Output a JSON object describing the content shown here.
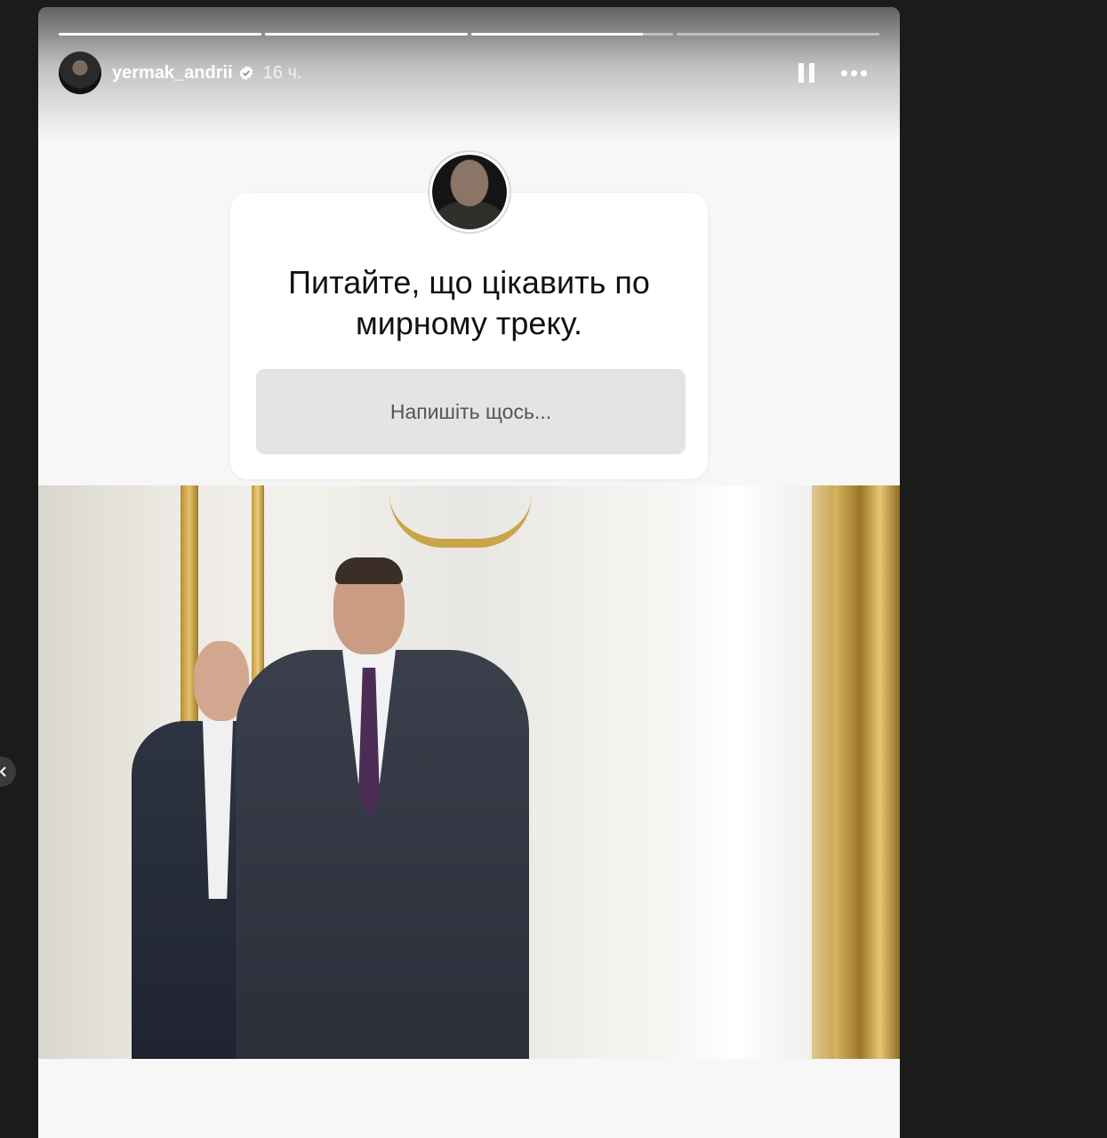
{
  "story": {
    "username": "yermak_andrii",
    "time_ago": "16 ч.",
    "progress": [
      1.0,
      1.0,
      0.85,
      0.0
    ]
  },
  "question_sticker": {
    "question": "Питайте, що цікавить по мирному треку.",
    "placeholder": "Напишіть щось..."
  },
  "icons": {
    "verified": "verified-badge-icon",
    "pause": "pause-icon",
    "more": "more-horizontal-icon",
    "prev": "chevron-left-icon"
  }
}
